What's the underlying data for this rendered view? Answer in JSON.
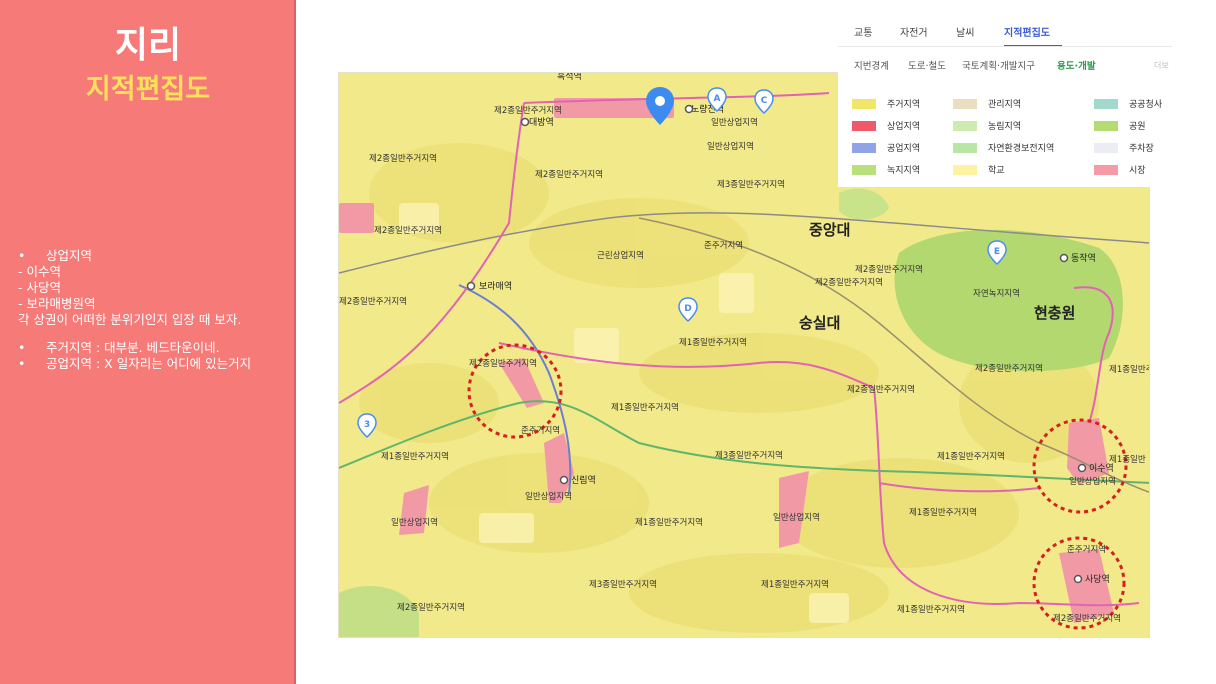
{
  "slide": {
    "title": "지리",
    "subtitle": "지적편집도",
    "notes": {
      "bullet1": "상업지역",
      "line1": "- 이수역",
      "line2": "- 사당역",
      "line3": "- 보라매병원역",
      "line4": "각 상권이 어떠한 분위기인지 입장 때 보자.",
      "bullet2": "주거지역 : 대부분. 베드타운이네.",
      "bullet3": "공업지역 : X 일자리는 어디에 있는거지"
    }
  },
  "map_tabs": [
    "교통",
    "자전거",
    "날씨",
    "지적편집도"
  ],
  "map_subtabs": [
    "지번경계",
    "도로·철도",
    "국토계획·개발지구",
    "용도·개발",
    "더보"
  ],
  "legend": {
    "col1": [
      {
        "label": "주거지역",
        "color": "#f2e56b"
      },
      {
        "label": "상업지역",
        "color": "#ef5a6a"
      },
      {
        "label": "공업지역",
        "color": "#8fa3e6"
      },
      {
        "label": "녹지지역",
        "color": "#b8e07c"
      }
    ],
    "col2": [
      {
        "label": "관리지역",
        "color": "#e9dfc0"
      },
      {
        "label": "농림지역",
        "color": "#cdebb1"
      },
      {
        "label": "자연환경보전지역",
        "color": "#b9e6a5"
      },
      {
        "label": "학교",
        "color": "#fdf3a2"
      }
    ],
    "col3": [
      {
        "label": "공공청사",
        "color": "#a3d9cc"
      },
      {
        "label": "공원",
        "color": "#b3dd72"
      },
      {
        "label": "주차장",
        "color": "#ebecf4"
      },
      {
        "label": "시장",
        "color": "#f59aa6"
      }
    ]
  },
  "map": {
    "areas": {
      "a1": "중앙대",
      "a2": "숭실대",
      "a3": "현충원"
    },
    "stations": {
      "s1": "흑석역",
      "s2": "노량진역",
      "s3": "대방역",
      "s4": "보라매역",
      "s5": "신림역",
      "s6": "동작역",
      "s7": "이수역",
      "s8": "사당역"
    },
    "zones": {
      "z1": "제2종일반주거지역",
      "z2": "제2종일반주거지역",
      "z3": "제2종일반주거지역",
      "z4": "제2종일반주거지역",
      "z5": "일반상업지역",
      "z6": "제3종일반주거지역",
      "z7": "근린상업지역",
      "z8": "준주거지역",
      "z9": "제2종일반주거지역",
      "z10": "제2종일반주거지역",
      "z11": "자연녹지지역",
      "z12": "제1종일반주거지역",
      "z13": "제1종일반주거지역",
      "z14": "제2종일반주거지역",
      "z15": "제2종일반주거지역",
      "z16": "제1종일반주거지역",
      "z17": "제2종일반주거지역",
      "z18": "준주거지역",
      "z19": "제3종일반주거지역",
      "z20": "제2종일반주거지역",
      "z21": "제1종일반주거지역",
      "z22": "일반상업지역",
      "z23": "일반상업지역",
      "z24": "제1종일반주거지역",
      "z25": "제1종일반주거지역",
      "z26": "일반상업지역",
      "z27": "준주거지역",
      "z28": "제3종일반주거지역",
      "z29": "제1종일반주거지역",
      "z30": "제2종일반주거지역",
      "z31": "제1종일반주거지역",
      "z32": "제2종일반주거지역",
      "z33": "제1종일반",
      "z34": "일반상업지역",
      "z35": "제1종일반주거지역",
      "z36": "일반상업지역"
    },
    "markers": {
      "m1": "A",
      "m2": "C",
      "m3": "E",
      "m4": "D",
      "m5": "3"
    },
    "marker_color": "#4a8df0"
  }
}
